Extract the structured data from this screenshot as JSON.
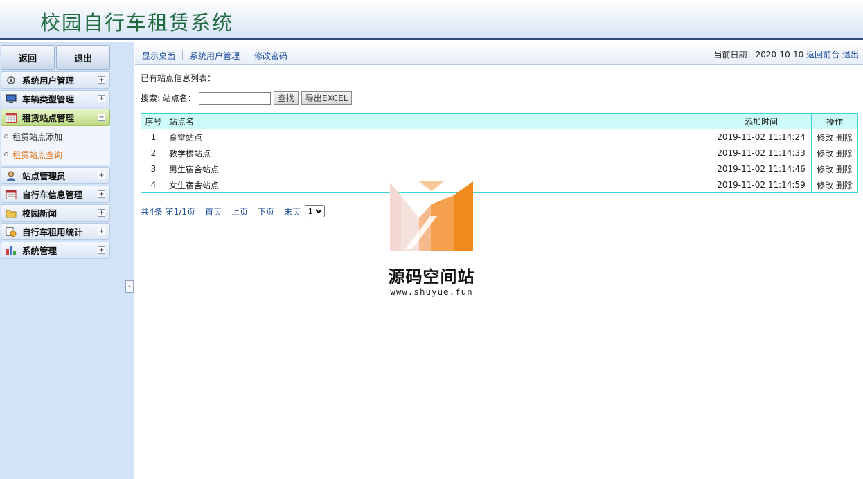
{
  "app": {
    "title": "校园自行车租赁系统"
  },
  "sidebar": {
    "back_label": "返回",
    "logout_label": "退出",
    "menus": [
      {
        "label": "系统用户管理",
        "icon": "gear-icon",
        "expanded": false
      },
      {
        "label": "车辆类型管理",
        "icon": "monitor-icon",
        "expanded": false
      },
      {
        "label": "租赁站点管理",
        "icon": "calendar-grid-icon",
        "expanded": true,
        "items": [
          {
            "label": "租赁站点添加"
          },
          {
            "label": "租赁站点查询",
            "current": true
          }
        ]
      },
      {
        "label": "站点管理员",
        "icon": "user-icon",
        "expanded": false
      },
      {
        "label": "自行车信息管理",
        "icon": "calculator-icon",
        "expanded": false
      },
      {
        "label": "校园新闻",
        "icon": "folder-icon",
        "expanded": false
      },
      {
        "label": "自行车租用统计",
        "icon": "document-coins-icon",
        "expanded": false
      },
      {
        "label": "系统管理",
        "icon": "bar-chart-icon",
        "expanded": false
      }
    ],
    "plus": "+",
    "minus": "−",
    "collapse_glyph": "‹"
  },
  "topbar": {
    "tabs": [
      "显示桌面",
      "系统用户管理",
      "修改密码"
    ],
    "date_label": "当前日期：",
    "date_value": "2020-10-10",
    "home_link": "返回前台",
    "logout_link": "退出"
  },
  "content": {
    "list_title": "已有站点信息列表：",
    "search_label": "搜索: 站点名：",
    "search_value": "",
    "find_button": "查找",
    "export_button": "导出EXCEL",
    "columns": [
      "序号",
      "站点名",
      "添加时间",
      "操作"
    ],
    "rows": [
      {
        "no": "1",
        "name": "食堂站点",
        "time": "2019-11-02 11:14:24"
      },
      {
        "no": "2",
        "name": "教学楼站点",
        "time": "2019-11-02 11:14:33"
      },
      {
        "no": "3",
        "name": "男生宿舍站点",
        "time": "2019-11-02 11:14:46"
      },
      {
        "no": "4",
        "name": "女生宿舍站点",
        "time": "2019-11-02 11:14:59"
      }
    ],
    "edit_label": "修改",
    "delete_label": "删除"
  },
  "pager": {
    "total": "共4条",
    "page_info": "第1/1页",
    "first": "首页",
    "prev": "上页",
    "next": "下页",
    "last": "末页",
    "page_options": [
      "1"
    ],
    "selected_page": "1"
  },
  "watermark": {
    "text": "源码空间站",
    "url": "www.shuyue.fun"
  }
}
